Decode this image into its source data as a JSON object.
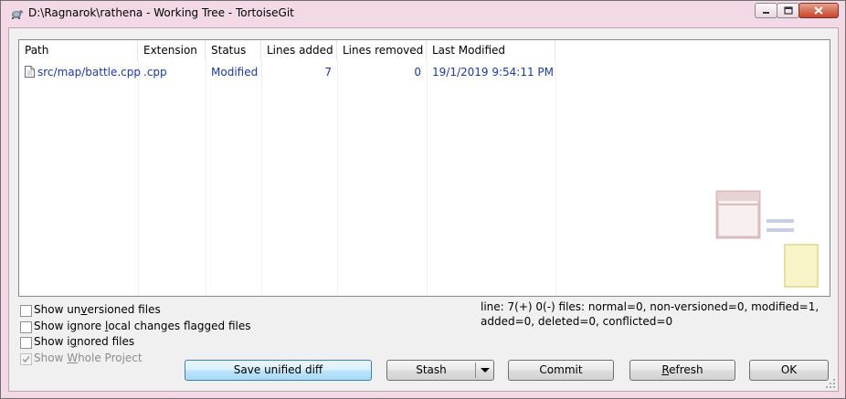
{
  "window": {
    "title": "D:\\Ragnarok\\rathena - Working Tree - TortoiseGit",
    "controls": {
      "minimize": "minimize",
      "maximize": "maximize",
      "close": "close"
    }
  },
  "columns": [
    {
      "label": "Path"
    },
    {
      "label": "Extension"
    },
    {
      "label": "Status"
    },
    {
      "label": "Lines added"
    },
    {
      "label": "Lines removed"
    },
    {
      "label": "Last Modified"
    }
  ],
  "rows": [
    {
      "path": "src/map/battle.cpp",
      "extension": ".cpp",
      "status": "Modified",
      "lines_added": "7",
      "lines_removed": "0",
      "last_modified": "19/1/2019 9:54:11 PM"
    }
  ],
  "options": {
    "unversioned": {
      "pre": "Show un",
      "key": "v",
      "post": "ersioned files",
      "checked": false
    },
    "ignore_local": {
      "pre": "Show ignore ",
      "key": "l",
      "post": "ocal changes flagged files",
      "checked": false
    },
    "ignored": {
      "pre": "Show i",
      "key": "g",
      "post": "nored files",
      "checked": false
    },
    "whole_project": {
      "pre": "Show ",
      "key": "W",
      "post": "hole Project",
      "checked": true,
      "disabled": true
    }
  },
  "stats": {
    "line1": "line: 7(+) 0(-) files: normal=0, non-versioned=0, modified=1,",
    "line2": "added=0, deleted=0, conflicted=0"
  },
  "buttons": {
    "save_diff": "Save unified diff",
    "stash": "Stash",
    "commit": "Commit",
    "refresh_pre": "",
    "refresh_key": "R",
    "refresh_post": "efresh",
    "ok": "OK"
  },
  "colors": {
    "titlebar": "#f3d9e6",
    "row_text": "#1c3a9e",
    "default_button": "#bee6fd"
  }
}
